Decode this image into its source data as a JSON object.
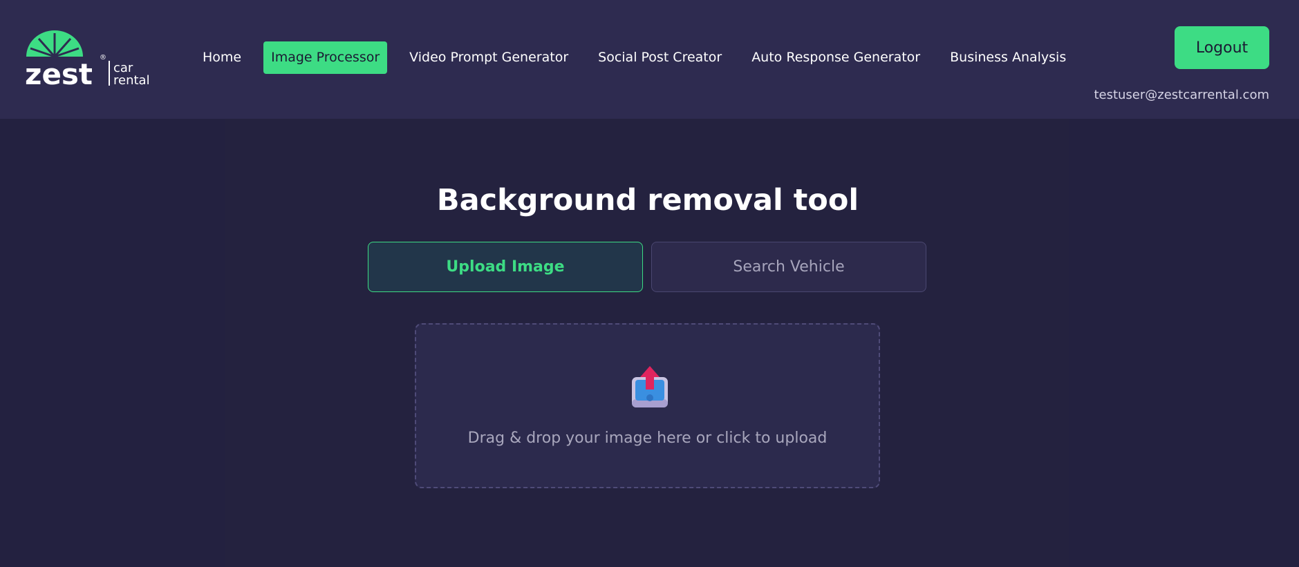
{
  "brand": {
    "logo_word": "zest",
    "logo_sub_1": "car",
    "logo_sub_2": "rental",
    "logo_mark": "®",
    "accent_color": "#3ddc84"
  },
  "nav": {
    "items": [
      {
        "label": "Home",
        "active": false
      },
      {
        "label": "Image Processor",
        "active": true
      },
      {
        "label": "Video Prompt Generator",
        "active": false
      },
      {
        "label": "Social Post Creator",
        "active": false
      },
      {
        "label": "Auto Response Generator",
        "active": false
      },
      {
        "label": "Business Analysis",
        "active": false
      }
    ]
  },
  "header": {
    "logout_label": "Logout",
    "user_email": "testuser@zestcarrental.com"
  },
  "main": {
    "title": "Background removal tool",
    "tabs": {
      "upload_label": "Upload Image",
      "search_label": "Search Vehicle"
    },
    "dropzone": {
      "icon": "upload-tray-icon",
      "text": "Drag & drop your image here or click to upload"
    }
  }
}
